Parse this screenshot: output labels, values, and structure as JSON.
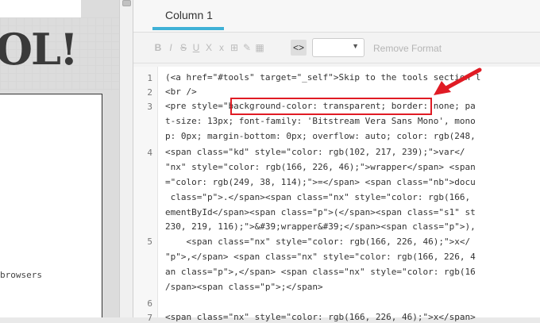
{
  "left": {
    "logo_text": "OL!",
    "browsers_text": "browsers"
  },
  "tab": {
    "label": "Column 1"
  },
  "toolbar": {
    "buttons": [
      "B",
      "I",
      "S",
      "U",
      "X",
      "x",
      "⊞",
      "✎",
      "▦",
      "<>"
    ],
    "remove_format_label": "Remove Format",
    "format_select_value": ""
  },
  "editor": {
    "lines": [
      {
        "n": "1",
        "text": "(<a href=\"#tools\" target=\"_self\">Skip to the tools section l"
      },
      {
        "n": "2",
        "text": "<br />"
      },
      {
        "n": "3",
        "text": "<pre style=\"background-color: transparent; border: none; pa"
      },
      {
        "n": "",
        "text": "t-size: 13px; font-family: 'Bitstream Vera Sans Mono', mono"
      },
      {
        "n": "",
        "text": "p: 0px; margin-bottom: 0px; overflow: auto; color: rgb(248,"
      },
      {
        "n": "4",
        "text": "<span class=\"kd\" style=\"color: rgb(102, 217, 239);\">var</"
      },
      {
        "n": "",
        "text": "\"nx\" style=\"color: rgb(166, 226, 46);\">wrapper</span> <span"
      },
      {
        "n": "",
        "text": "=\"color: rgb(249, 38, 114);\">=</span> <span class=\"nb\">docu"
      },
      {
        "n": "",
        "text": " class=\"p\">.</span><span class=\"nx\" style=\"color: rgb(166,"
      },
      {
        "n": "",
        "text": "ementById</span><span class=\"p\">(</span><span class=\"s1\" st"
      },
      {
        "n": "",
        "text": "230, 219, 116);\">&#39;wrapper&#39;</span><span class=\"p\">),"
      },
      {
        "n": "5",
        "text": "    <span class=\"nx\" style=\"color: rgb(166, 226, 46);\">x</"
      },
      {
        "n": "",
        "text": "\"p\">,</span> <span class=\"nx\" style=\"color: rgb(166, 226, 4"
      },
      {
        "n": "",
        "text": "an class=\"p\">,</span> <span class=\"nx\" style=\"color: rgb(16"
      },
      {
        "n": "",
        "text": "/span><span class=\"p\">;</span>"
      },
      {
        "n": "6",
        "text": ""
      },
      {
        "n": "7",
        "text": "<span class=\"nx\" style=\"color: rgb(166, 226, 46);\">x</span>"
      }
    ]
  },
  "colors": {
    "tab_accent": "#3fb1d6",
    "highlight_border": "#e01b24",
    "arrow": "#e01b24"
  }
}
